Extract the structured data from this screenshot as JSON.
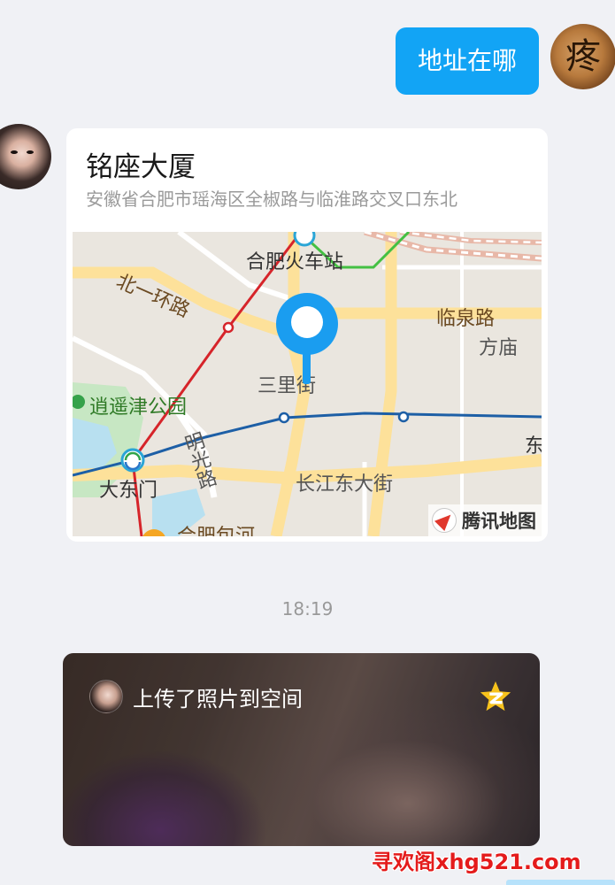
{
  "messages": {
    "outgoing_text": "地址在哪",
    "my_avatar_glyph": "疼"
  },
  "location_card": {
    "title": "铭座大厦",
    "address": "安徽省合肥市瑶海区全椒路与临淮路交叉口东北",
    "map_labels": {
      "station": "合肥火车站",
      "ring_road": "北一环路",
      "linquan_road": "临泉路",
      "fangmiao": "方庙",
      "sanlijie": "三里街",
      "park": "逍遥津公园",
      "mingguang_road": "明光路",
      "dadongmen": "大东门",
      "changjiang_street": "长江东大街",
      "baohe": "合肥包河",
      "east_cut": "东"
    },
    "map_logo": "腾讯地图"
  },
  "timestamp": "18:19",
  "photo_share": {
    "text": "上传了照片到空间"
  },
  "watermark": "寻欢阁xhg521.com",
  "colors": {
    "bubble": "#12a4f5",
    "background": "#f0f1f5",
    "pin": "#1a9df0",
    "metro_red": "#d6242a",
    "metro_blue": "#1d5fa6",
    "road_yellow": "#fde19a"
  },
  "icons": {
    "pin": "location-pin-icon",
    "compass": "compass-icon",
    "qzone": "qzone-star-icon",
    "metro": "metro-station-icon"
  }
}
